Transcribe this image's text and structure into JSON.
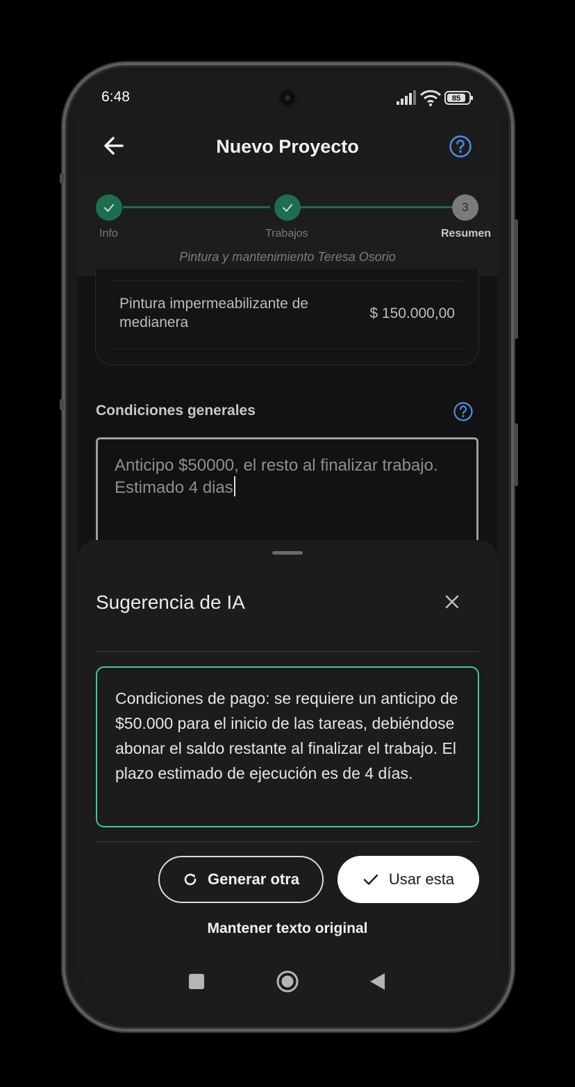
{
  "status_bar": {
    "time": "6:48",
    "battery": "85"
  },
  "header": {
    "title": "Nuevo Proyecto"
  },
  "stepper": {
    "steps": [
      {
        "label": "Info",
        "state": "done"
      },
      {
        "label": "Trabajos",
        "state": "done"
      },
      {
        "label": "Resumen",
        "number": "3",
        "state": "current"
      }
    ],
    "subtitle": "Pintura y mantenimiento Teresa Osorio"
  },
  "item": {
    "name": "Pintura impermeabilizante de medianera",
    "price": "$ 150.000,00"
  },
  "conditions": {
    "label": "Condiciones generales",
    "value": "Anticipo $50000, el resto al finalizar trabajo. Estimado 4 dias"
  },
  "sheet": {
    "title": "Sugerencia de IA",
    "suggestion": "Condiciones de pago: se requiere un anticipo de $50.000 para el inicio de las tareas, debiéndose abonar el saldo restante al finalizar el trabajo. El plazo estimado de ejecución es de 4 días.",
    "regenerate_label": "Generar otra",
    "use_label": "Usar esta",
    "keep_label": "Mantener texto original"
  },
  "colors": {
    "accent_green": "#1c6e4f",
    "suggestion_border": "#3bc9a3",
    "help_blue": "#4a90e2"
  }
}
